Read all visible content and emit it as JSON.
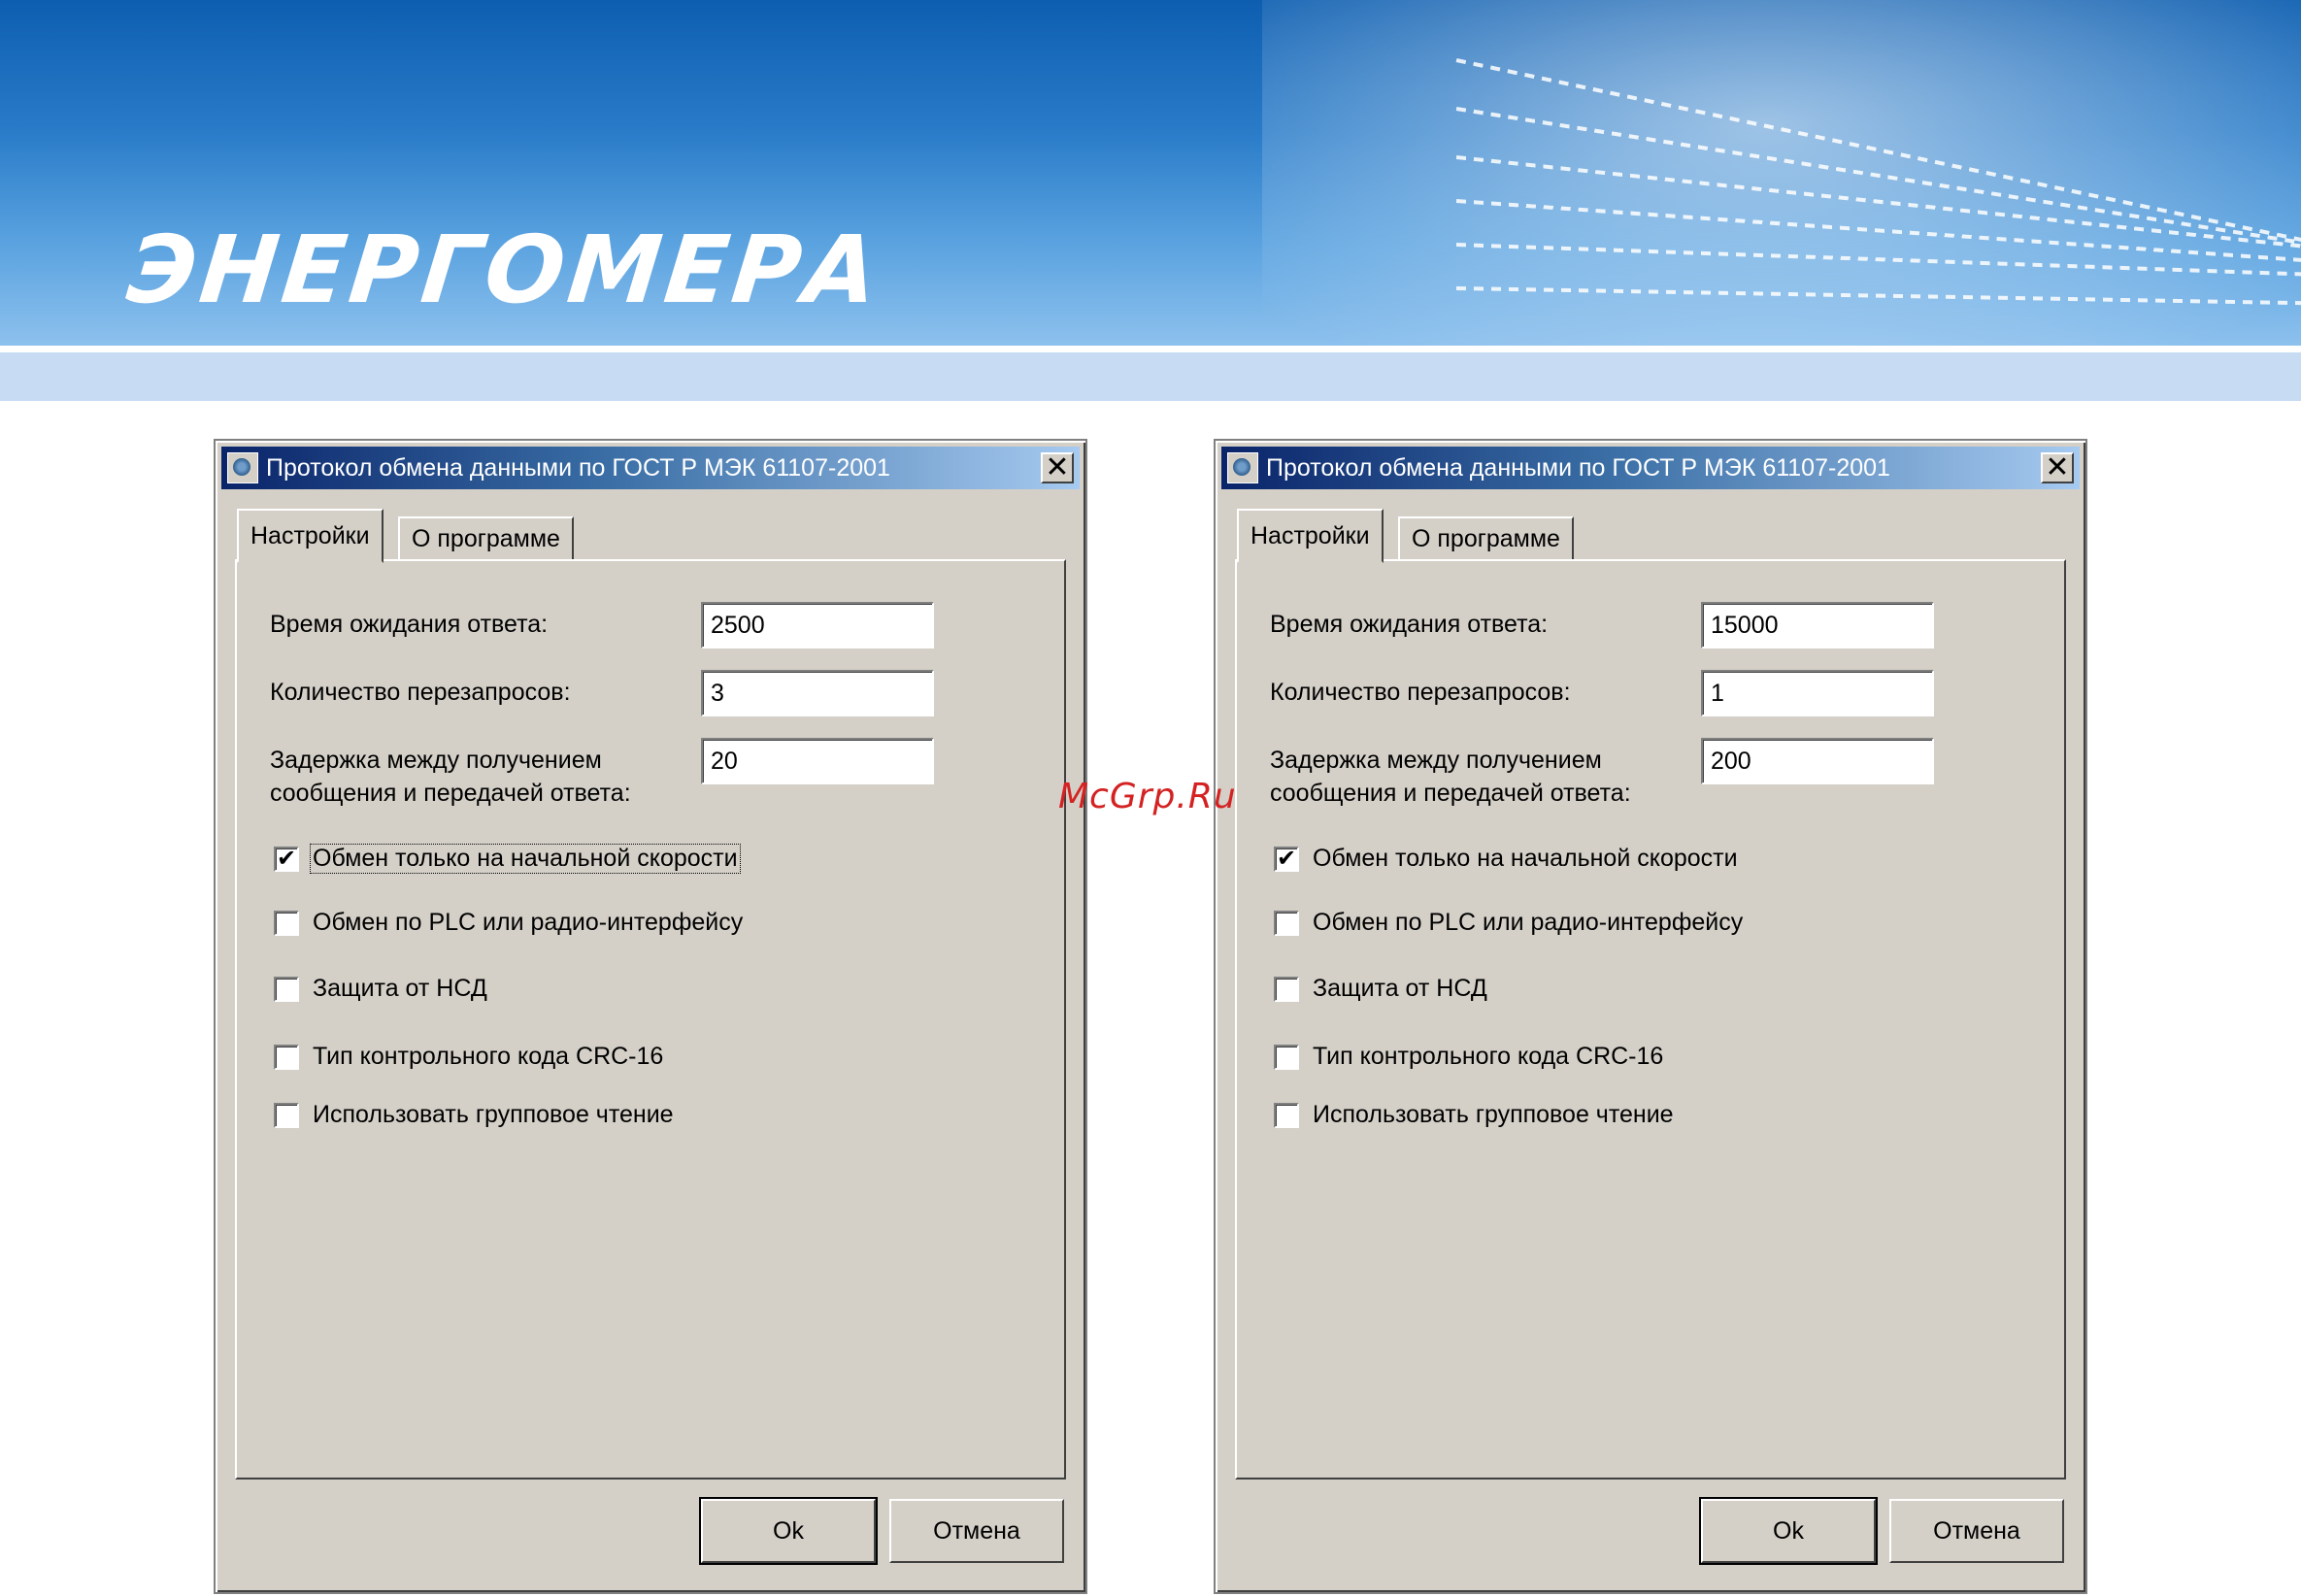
{
  "header": {
    "logo_text": "ЭНЕРГОМЕРА",
    "watermark": "McGrp.Ru",
    "colors": {
      "banner_dark": "#0d5eb0",
      "banner_light": "#8fc2ee",
      "subbar": "#c7dcf2",
      "watermark": "#d42222"
    }
  },
  "dialogs": [
    {
      "title": "Протокол обмена данными по ГОСТ Р МЭК 61107-2001",
      "close_icon": "close-icon",
      "tabs": {
        "settings": "Настройки",
        "about": "О программе"
      },
      "fields": {
        "response_timeout": {
          "label": "Время ожидания ответа:",
          "value": "2500"
        },
        "retry_count": {
          "label": "Количество перезапросов:",
          "value": "3"
        },
        "delay": {
          "label_line1": "Задержка между получением",
          "label_line2": "сообщения и передачей ответа:",
          "value": "20"
        }
      },
      "checkboxes": [
        {
          "label": "Обмен только на начальной скорости",
          "checked": "✔"
        },
        {
          "label": "Обмен по PLC или радио-интерфейсу",
          "checked": ""
        },
        {
          "label": "Защита от НСД",
          "checked": ""
        },
        {
          "label": "Тип контрольного кода CRC-16",
          "checked": ""
        },
        {
          "label": "Использовать групповое чтение",
          "checked": ""
        }
      ],
      "buttons": {
        "ok": "Ok",
        "cancel": "Отмена"
      }
    },
    {
      "title": "Протокол обмена данными по ГОСТ Р МЭК 61107-2001",
      "close_icon": "close-icon",
      "tabs": {
        "settings": "Настройки",
        "about": "О программе"
      },
      "fields": {
        "response_timeout": {
          "label": "Время ожидания ответа:",
          "value": "15000"
        },
        "retry_count": {
          "label": "Количество перезапросов:",
          "value": "1"
        },
        "delay": {
          "label_line1": "Задержка между получением",
          "label_line2": "сообщения и передачей ответа:",
          "value": "200"
        }
      },
      "checkboxes": [
        {
          "label": "Обмен только на начальной скорости",
          "checked": "✔"
        },
        {
          "label": "Обмен по PLC или радио-интерфейсу",
          "checked": ""
        },
        {
          "label": "Защита от НСД",
          "checked": ""
        },
        {
          "label": "Тип контрольного кода CRC-16",
          "checked": ""
        },
        {
          "label": "Использовать групповое чтение",
          "checked": ""
        }
      ],
      "buttons": {
        "ok": "Ok",
        "cancel": "Отмена"
      }
    }
  ]
}
